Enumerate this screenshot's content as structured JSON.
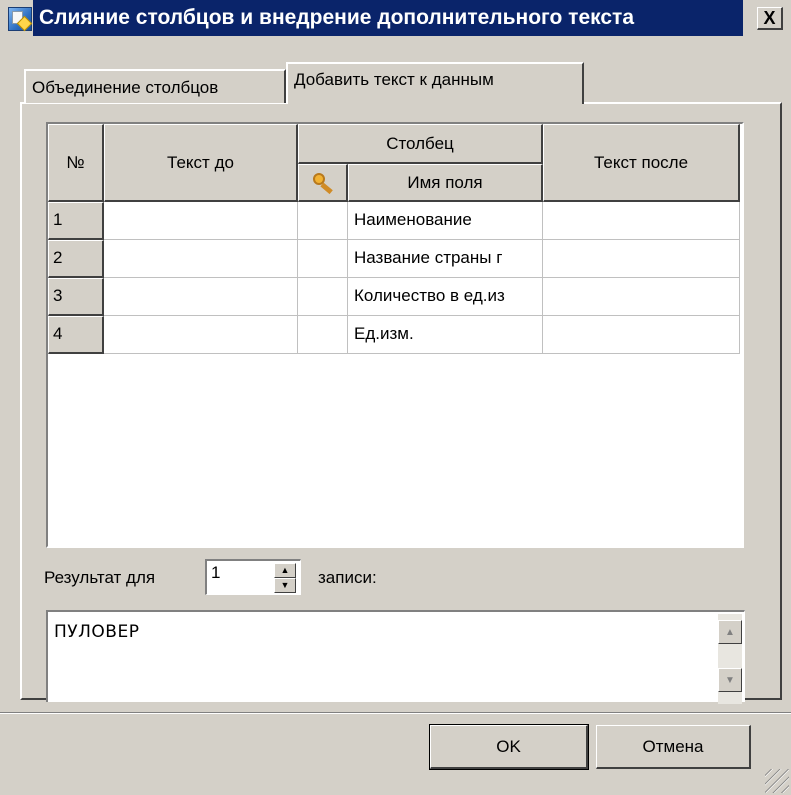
{
  "window": {
    "title": "Слияние столбцов и внедрение дополнительного текста",
    "close_label": "X"
  },
  "tabs": [
    {
      "label": "Объединение столбцов",
      "active": false
    },
    {
      "label": "Добавить текст к данным",
      "active": true
    }
  ],
  "grid": {
    "headers": {
      "num": "№",
      "text_before": "Текст до",
      "column_group": "Столбец",
      "field_name": "Имя поля",
      "text_after": "Текст после"
    },
    "rows": [
      {
        "num": "1",
        "text_before": "",
        "field": "Наименование",
        "text_after": ""
      },
      {
        "num": "2",
        "text_before": "",
        "field": "Название страны г",
        "text_after": ""
      },
      {
        "num": "3",
        "text_before": "",
        "field": "Количество в ед.из",
        "text_after": ""
      },
      {
        "num": "4",
        "text_before": "",
        "field": "Ед.изм.",
        "text_after": ""
      }
    ]
  },
  "result": {
    "label": "Результат для",
    "record_value": "1",
    "suffix": "записи:",
    "text": "ПУЛОВЕР"
  },
  "buttons": {
    "ok": "OK",
    "cancel": "Отмена"
  },
  "icons": {
    "app": "app-icon",
    "key": "key-icon"
  }
}
